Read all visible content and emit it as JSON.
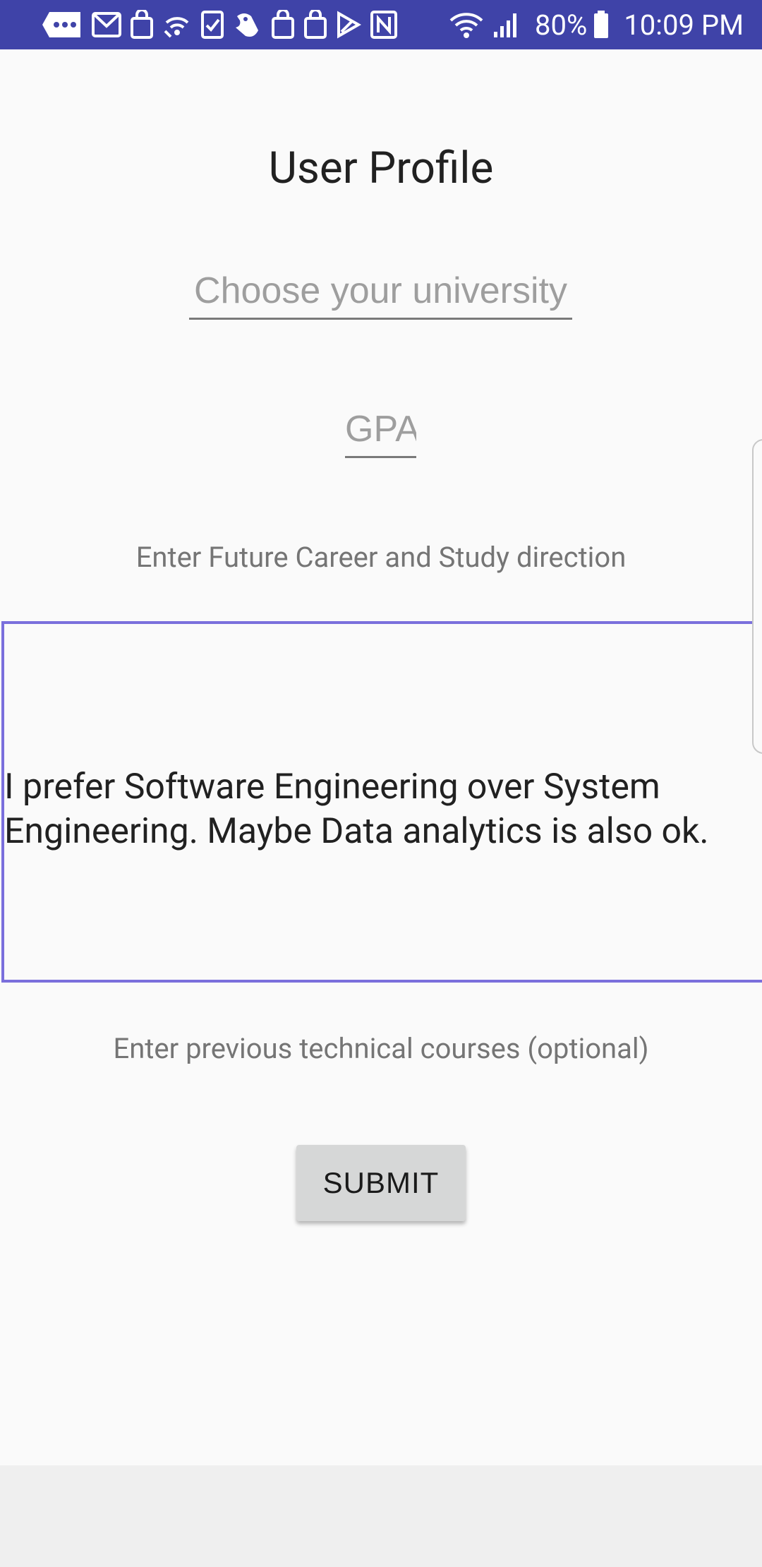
{
  "status_bar": {
    "battery": "80%",
    "time": "10:09 PM",
    "icons": [
      "message-icon",
      "gmail-icon",
      "shopping-bag-icon",
      "wifi-call-icon",
      "checklist-icon",
      "bird-app-icon",
      "shopping-bag-icon",
      "shopping-bag-icon",
      "play-store-icon",
      "nfc-icon",
      "wifi-icon",
      "signal-icon",
      "battery-icon"
    ]
  },
  "page": {
    "title": "User Profile"
  },
  "form": {
    "university_placeholder": "Choose your university",
    "gpa_placeholder": "GPA",
    "career_label": "Enter Future Career and Study direction",
    "career_value": "I prefer Software Engineering over System Engineering. Maybe Data analytics is also ok.",
    "courses_label": "Enter previous technical courses (optional)",
    "submit_label": "SUBMIT"
  },
  "colors": {
    "status_bar": "#3f43a8",
    "focus_border": "#7a6fdc",
    "button_bg": "#d6d7d7"
  }
}
